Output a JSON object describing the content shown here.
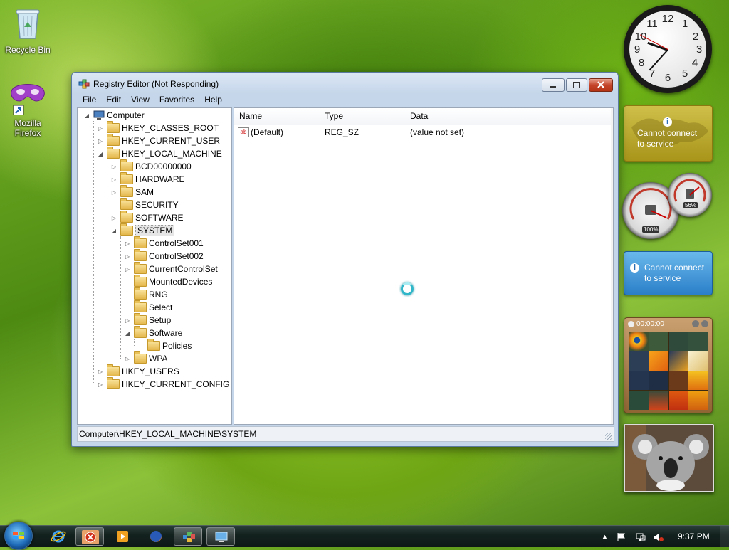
{
  "desktop": {
    "icons": [
      {
        "label": "Recycle Bin"
      },
      {
        "label": "Mozilla Firefox"
      }
    ]
  },
  "window": {
    "title": "Registry Editor (Not Responding)",
    "menu": [
      "File",
      "Edit",
      "View",
      "Favorites",
      "Help"
    ],
    "tree": [
      {
        "label": "Computer",
        "expander": "◢",
        "kind": "computer"
      },
      {
        "label": "HKEY_CLASSES_ROOT",
        "expander": "▷"
      },
      {
        "label": "HKEY_CURRENT_USER",
        "expander": "▷"
      },
      {
        "label": "HKEY_LOCAL_MACHINE",
        "expander": "◢"
      },
      {
        "label": "BCD00000000",
        "expander": "▷"
      },
      {
        "label": "HARDWARE",
        "expander": "▷"
      },
      {
        "label": "SAM",
        "expander": "▷"
      },
      {
        "label": "SECURITY",
        "expander": ""
      },
      {
        "label": "SOFTWARE",
        "expander": "▷"
      },
      {
        "label": "SYSTEM",
        "expander": "◢",
        "selected": true
      },
      {
        "label": "ControlSet001",
        "expander": "▷"
      },
      {
        "label": "ControlSet002",
        "expander": "▷"
      },
      {
        "label": "CurrentControlSet",
        "expander": "▷"
      },
      {
        "label": "MountedDevices",
        "expander": ""
      },
      {
        "label": "RNG",
        "expander": ""
      },
      {
        "label": "Select",
        "expander": ""
      },
      {
        "label": "Setup",
        "expander": "▷"
      },
      {
        "label": "Software",
        "expander": "◢"
      },
      {
        "label": "Policies",
        "expander": ""
      },
      {
        "label": "WPA",
        "expander": "▷"
      },
      {
        "label": "HKEY_USERS",
        "expander": "▷"
      },
      {
        "label": "HKEY_CURRENT_CONFIG",
        "expander": "▷"
      }
    ],
    "columns": [
      "Name",
      "Type",
      "Data"
    ],
    "values": [
      {
        "icon": "ab",
        "name": "(Default)",
        "type": "REG_SZ",
        "data": "(value not set)"
      }
    ],
    "status": "Computer\\HKEY_LOCAL_MACHINE\\SYSTEM"
  },
  "gadgets": {
    "clock_numbers": [
      "12",
      "1",
      "2",
      "3",
      "4",
      "5",
      "6",
      "7",
      "8",
      "9",
      "10",
      "11"
    ],
    "feed_message": "Cannot connect to service",
    "weather_message": "Cannot connect to service",
    "cpu_percent": "100%",
    "memory_percent": "56%",
    "puzzle_timer": "00:00:00",
    "info_glyph": "i"
  },
  "taskbar": {
    "time": "9:37 PM",
    "icons": [
      "start-orb",
      "internet-explorer-icon",
      "error-app-icon",
      "media-player-icon",
      "firefox-icon",
      "registry-editor-icon",
      "remote-desktop-icon"
    ]
  },
  "colors": {
    "accent_window": "#c5d6ea",
    "close_button": "#c4452a",
    "selection": "#e6e6e6"
  }
}
